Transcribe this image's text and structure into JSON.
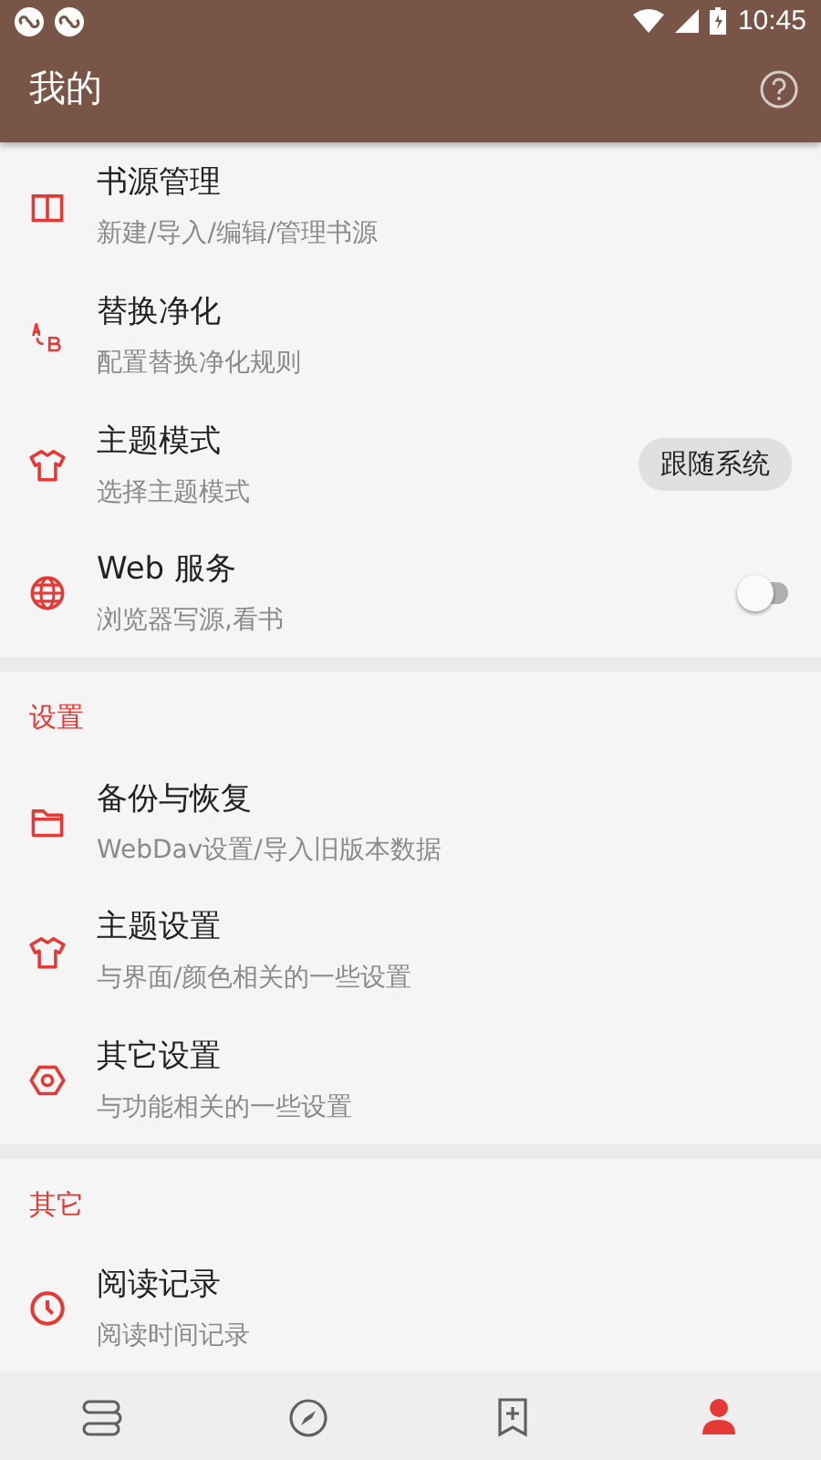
{
  "status_bar": {
    "time": "10:45"
  },
  "app_bar": {
    "title": "我的"
  },
  "sections": [
    {
      "items": [
        {
          "kind": "plain",
          "title": "书源管理",
          "subtitle": "新建/导入/编辑/管理书源"
        },
        {
          "kind": "plain",
          "title": "替换净化",
          "subtitle": "配置替换净化规则"
        },
        {
          "kind": "chip",
          "title": "主题模式",
          "subtitle": "选择主题模式",
          "value": "跟随系统"
        },
        {
          "kind": "switch",
          "title": "Web 服务",
          "subtitle": "浏览器写源,看书",
          "on": false
        }
      ]
    },
    {
      "header": "设置",
      "items": [
        {
          "kind": "plain",
          "title": "备份与恢复",
          "subtitle": "WebDav设置/导入旧版本数据"
        },
        {
          "kind": "plain",
          "title": "主题设置",
          "subtitle": "与界面/颜色相关的一些设置"
        },
        {
          "kind": "plain",
          "title": "其它设置",
          "subtitle": "与功能相关的一些设置"
        }
      ]
    },
    {
      "header": "其它",
      "items": [
        {
          "kind": "plain",
          "title": "阅读记录",
          "subtitle": "阅读时间记录"
        }
      ]
    }
  ],
  "bottom_nav": [
    {
      "selected": false
    },
    {
      "selected": false
    },
    {
      "selected": false
    },
    {
      "selected": true
    }
  ]
}
